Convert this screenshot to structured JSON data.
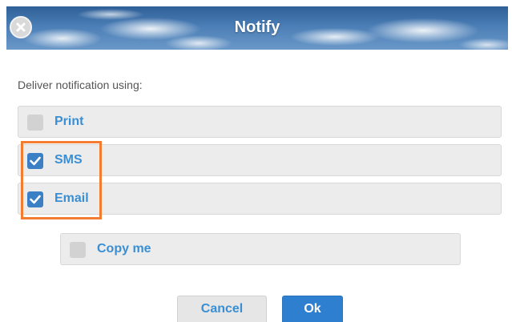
{
  "dialog": {
    "title": "Notify",
    "close_icon": "close-icon",
    "prompt": "Deliver notification using:"
  },
  "options": [
    {
      "label": "Print",
      "checked": false
    },
    {
      "label": "SMS",
      "checked": true
    },
    {
      "label": "Email",
      "checked": true
    }
  ],
  "copy_me": {
    "label": "Copy me",
    "checked": false
  },
  "buttons": {
    "cancel": "Cancel",
    "ok": "Ok"
  },
  "colors": {
    "accent": "#3a8fd4",
    "checkbox_checked": "#3b7fc4",
    "checkbox_unchecked": "#d2d2d2",
    "highlight": "#f47c30",
    "ok_button": "#2f7fd0"
  }
}
